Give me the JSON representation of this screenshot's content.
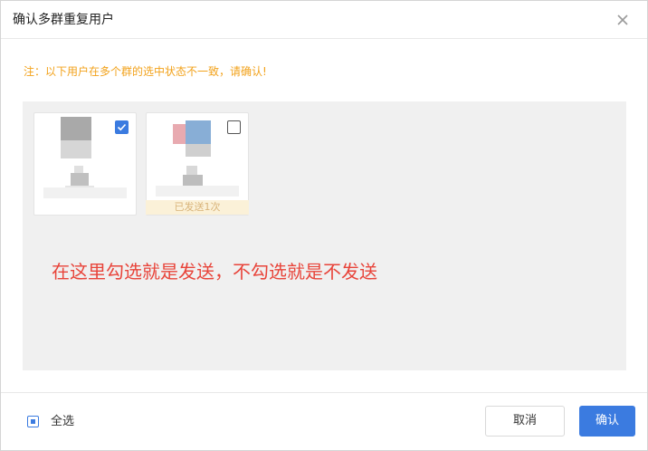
{
  "dialog": {
    "title": "确认多群重复用户",
    "close_icon": "close-icon",
    "notice": "注：以下用户在多个群的选中状态不一致，请确认!"
  },
  "users": [
    {
      "checked": true,
      "sent_badge": ""
    },
    {
      "checked": false,
      "sent_badge": "已发送1次"
    }
  ],
  "annotation": "在这里勾选就是发送，不勾选就是不发送",
  "footer": {
    "select_all_label": "全选",
    "cancel_label": "取消",
    "confirm_label": "确认"
  },
  "colors": {
    "accent": "#3b7be0",
    "notice": "#f2a21b",
    "annotation": "#e8443a",
    "badge_bg": "#fbf1d8"
  }
}
